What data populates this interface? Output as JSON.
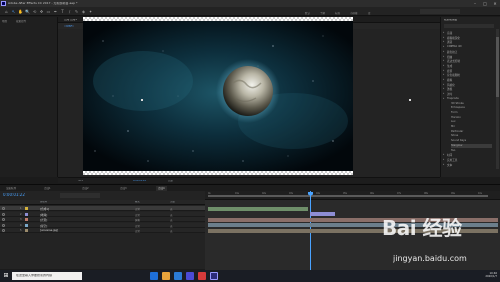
{
  "window": {
    "title": "Adobe After Effects CC 2017 - 无标题项目.aep *",
    "min_label": "–",
    "max_label": "□",
    "close_label": "✕"
  },
  "toolbar": {
    "tools": [
      "⌂",
      "↖",
      "✋",
      "🔍",
      "⟲",
      "✥",
      "▭",
      "✒",
      "T",
      "∕",
      "✎",
      "◈",
      "✦"
    ],
    "workspace_items": [
      "默认",
      "了解",
      "标准",
      "小屏幕",
      "库"
    ],
    "active_workspace": "默认"
  },
  "project_panel": {
    "tab": "项目",
    "effects_tab": "效果控件"
  },
  "comp_panel": {
    "tab": "合成 合成1",
    "layer_tab": "图层",
    "subtab": "合成1",
    "footer_zoom": "50%",
    "footer_time": "0:00:01:22",
    "footer_quality": "完整"
  },
  "right_panel": {
    "title": "效果和预设",
    "search_placeholder": "",
    "items": [
      {
        "label": "音频",
        "cat": true
      },
      {
        "label": "模糊和锐化",
        "cat": true
      },
      {
        "label": "通道",
        "cat": true
      },
      {
        "label": "CINEMA 4D",
        "cat": true
      },
      {
        "label": "颜色校正",
        "cat": true
      },
      {
        "label": "扭曲",
        "cat": true
      },
      {
        "label": "表达式控制",
        "cat": true
      },
      {
        "label": "生成",
        "cat": true
      },
      {
        "label": "遮罩",
        "cat": true
      },
      {
        "label": "杂色和颗粒",
        "cat": true
      },
      {
        "label": "模拟",
        "cat": true
      },
      {
        "label": "风格化",
        "cat": true
      },
      {
        "label": "透视",
        "cat": true
      },
      {
        "label": "过时",
        "cat": true
      },
      {
        "label": "Trapcode",
        "cat": true
      },
      {
        "label": "3D Stroke",
        "cat": false
      },
      {
        "label": "Echospace",
        "cat": false
      },
      {
        "label": "Form",
        "cat": false
      },
      {
        "label": "Horizon",
        "cat": false
      },
      {
        "label": "Lux",
        "cat": false
      },
      {
        "label": "Mir",
        "cat": false
      },
      {
        "label": "Particular",
        "cat": false
      },
      {
        "label": "Shine",
        "cat": false
      },
      {
        "label": "Sound Keys",
        "cat": false
      },
      {
        "label": "Starglow",
        "cat": false
      },
      {
        "label": "Tao",
        "cat": false
      },
      {
        "label": "时间",
        "cat": true
      },
      {
        "label": "实用工具",
        "cat": true
      },
      {
        "label": "文本",
        "cat": true
      }
    ],
    "highlighted": "Starglow"
  },
  "timeline": {
    "tabs": [
      "渲染队列",
      "合成1",
      "合成2",
      "合成3",
      "合成4"
    ],
    "active_tab": "合成4",
    "timecode": "0:00:01:22",
    "header": {
      "source": "源名称",
      "mode": "模式",
      "parent": "父级"
    },
    "layers": [
      {
        "num": "1",
        "name": "[合成1]",
        "color": "#d4b23c",
        "mode": "正常",
        "parent": "无",
        "selected": true
      },
      {
        "num": "2",
        "name": "[地球]",
        "color": "#8e8ed4",
        "mode": "正常",
        "parent": "无",
        "selected": false
      },
      {
        "num": "3",
        "name": "[光晕]",
        "color": "#c07b6b",
        "mode": "屏幕",
        "parent": "无",
        "selected": false
      },
      {
        "num": "4",
        "name": "[星空]",
        "color": "#7aa7c7",
        "mode": "正常",
        "parent": "无",
        "selected": false
      },
      {
        "num": "5",
        "name": "[universe.jpg]",
        "color": "#9a8a6b",
        "mode": "正常",
        "parent": "无",
        "selected": false
      }
    ],
    "ruler_ticks": [
      "0s",
      "01s",
      "02s",
      "03s",
      "04s",
      "05s",
      "06s",
      "07s",
      "08s",
      "09s",
      "10s"
    ],
    "playhead_time": "0:00:01:22"
  },
  "taskbar": {
    "search_placeholder": "在这里输入你要搜索的内容",
    "time": "10:46",
    "date": "2020/1/7"
  },
  "watermark": {
    "logo": "Bai 经验",
    "url": "jingyan.baidu.com"
  }
}
